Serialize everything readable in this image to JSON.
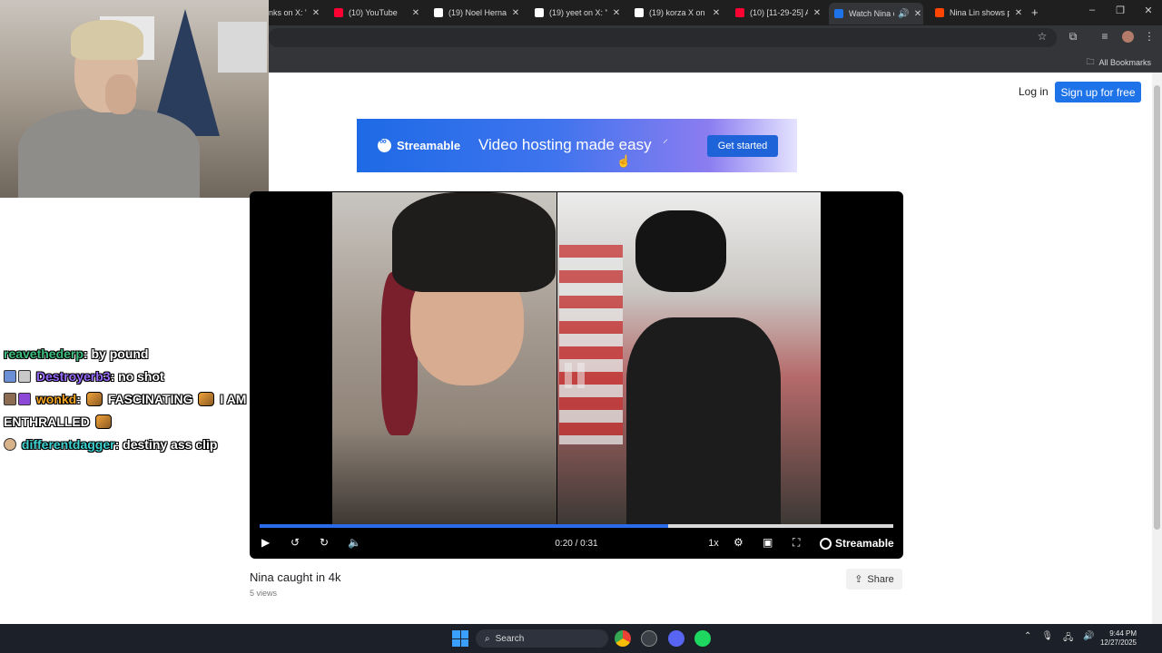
{
  "browser": {
    "tabs": [
      {
        "label": "nks on X: \"",
        "icon": "x-logo-icon",
        "color": "#ffffff",
        "active": false
      },
      {
        "label": "(10) YouTube",
        "icon": "youtube-icon",
        "color": "#ff0033",
        "active": false
      },
      {
        "label": "(19) Noel Hernan",
        "icon": "x-logo-icon",
        "color": "#ffffff",
        "active": false
      },
      {
        "label": "(19) yeet on X: \"N",
        "icon": "x-logo-icon",
        "color": "#ffffff",
        "active": false
      },
      {
        "label": "(19) korza X on X",
        "icon": "x-logo-icon",
        "color": "#ffffff",
        "active": false
      },
      {
        "label": "(10) [11-29-25] A",
        "icon": "youtube-icon",
        "color": "#ff0033",
        "active": false
      },
      {
        "label": "Watch Nina c",
        "icon": "streamable-icon",
        "color": "#1f73e8",
        "active": true
      },
      {
        "label": "Nina Lin shows p",
        "icon": "reddit-icon",
        "color": "#ff4500",
        "active": false
      }
    ],
    "new_tab_symbol": "+",
    "bookmarks_label": "All Bookmarks"
  },
  "header": {
    "login_label": "Log in",
    "signup_label": "Sign up for free"
  },
  "banner": {
    "brand": "Streamable",
    "tagline": "Video hosting made easy",
    "cta_label": "Get started"
  },
  "video": {
    "current_time": "0:20",
    "duration": "0:31",
    "time_readout": "0:20 / 0:31",
    "progress_fraction": 0.645,
    "speed_label": "1x",
    "brand": "Streamable",
    "title": "Nina caught in 4k",
    "views": "5 views",
    "share_label": "Share"
  },
  "chat": {
    "messages": [
      {
        "user": "reavethederp",
        "user_color": "#3fbf7f",
        "text": "by pound"
      },
      {
        "user": "Destroyerb3",
        "user_color": "#9a6cff",
        "text": "no shot"
      },
      {
        "user": "wonkd",
        "user_color": "#f5a623",
        "text_before": "FASCINATING",
        "text_after": "I AM ENTHRALLED"
      },
      {
        "user": "differentdagger",
        "user_color": "#3fd3d3",
        "text": "destiny ass clip"
      }
    ]
  },
  "taskbar": {
    "search_label": "Search",
    "time": "9:44 PM",
    "date": "12/27/2025"
  }
}
